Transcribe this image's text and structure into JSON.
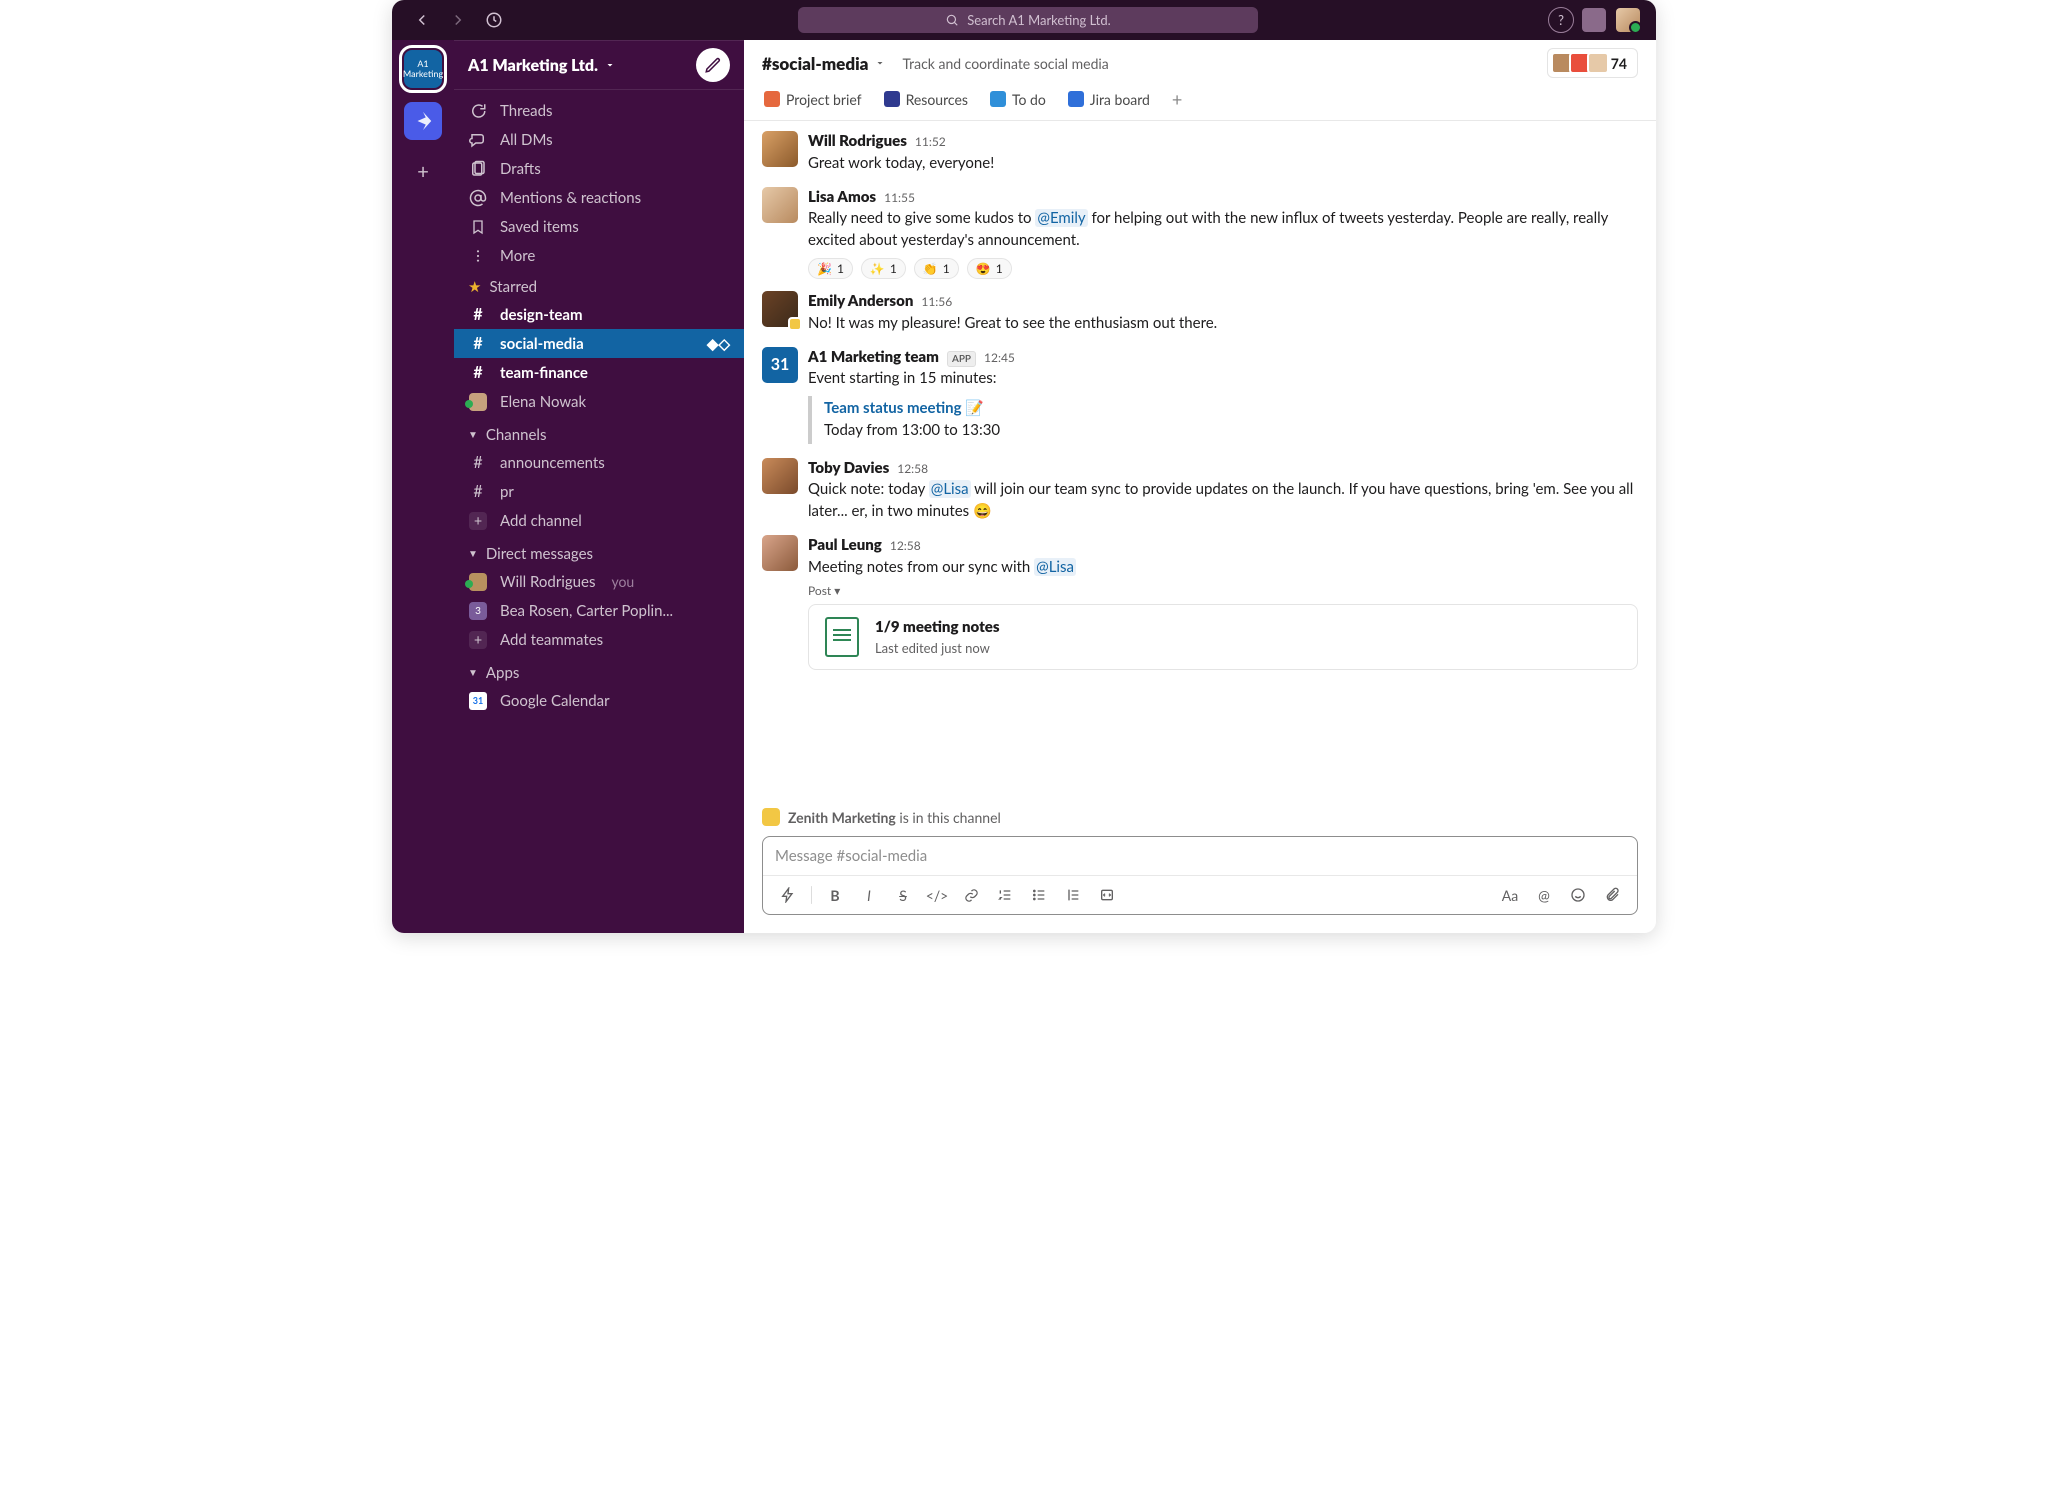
{
  "topbar": {
    "search_placeholder": "Search A1 Marketing Ltd."
  },
  "workspace": {
    "name": "A1 Marketing Ltd.",
    "rail_label": "A1\nMarketing"
  },
  "sidebar": {
    "nav": [
      {
        "icon": "threads-icon",
        "label": "Threads"
      },
      {
        "icon": "dms-icon",
        "label": "All DMs"
      },
      {
        "icon": "drafts-icon",
        "label": "Drafts"
      },
      {
        "icon": "mentions-icon",
        "label": "Mentions & reactions"
      },
      {
        "icon": "saved-icon",
        "label": "Saved items"
      },
      {
        "icon": "more-icon",
        "label": "More"
      }
    ],
    "starred_label": "Starred",
    "starred": [
      {
        "type": "channel",
        "name": "design-team",
        "bold": true
      },
      {
        "type": "channel",
        "name": "social-media",
        "bold": true,
        "active": true,
        "shared": true
      },
      {
        "type": "channel",
        "name": "team-finance",
        "bold": true
      },
      {
        "type": "dm",
        "name": "Elena Nowak"
      }
    ],
    "channels_label": "Channels",
    "channels": [
      {
        "name": "announcements"
      },
      {
        "name": "pr"
      }
    ],
    "add_channel": "Add channel",
    "dms_label": "Direct messages",
    "dms": [
      {
        "name": "Will Rodrigues",
        "you": "you"
      },
      {
        "name": "Bea Rosen, Carter Poplin...",
        "group": true,
        "count": "3"
      }
    ],
    "add_teammates": "Add teammates",
    "apps_label": "Apps",
    "apps": [
      {
        "name": "Google Calendar"
      }
    ]
  },
  "channel": {
    "name": "#social-media",
    "topic": "Track and coordinate social media",
    "member_count": "74",
    "bookmarks": [
      {
        "label": "Project brief",
        "color": "#e5683e"
      },
      {
        "label": "Resources",
        "color": "#2f3a8f"
      },
      {
        "label": "To do",
        "color": "#2f8fd9"
      },
      {
        "label": "Jira board",
        "color": "#2f6fd9"
      }
    ]
  },
  "messages": [
    {
      "author": "Will Rodrigues",
      "ts": "11:52",
      "avatar": "av-c1",
      "text": "Great work today, everyone!"
    },
    {
      "author": "Lisa Amos",
      "ts": "11:55",
      "avatar": "av-c2",
      "text_parts": [
        {
          "t": "Really need to give some kudos to "
        },
        {
          "mention": "@Emily"
        },
        {
          "t": " for helping out with the new influx of tweets yesterday. People are really, really excited about yesterday's announcement."
        }
      ],
      "reactions": [
        {
          "e": "🎉",
          "n": "1"
        },
        {
          "e": "✨",
          "n": "1"
        },
        {
          "e": "👏",
          "n": "1"
        },
        {
          "e": "😍",
          "n": "1"
        }
      ]
    },
    {
      "author": "Emily Anderson",
      "ts": "11:56",
      "avatar": "av-c3",
      "ext": true,
      "text": "No! It was my pleasure! Great to see the enthusiasm out there."
    },
    {
      "author": "A1 Marketing team",
      "ts": "12:45",
      "avatar": "av-c4",
      "avatar_text": "31",
      "app": true,
      "text": "Event starting in 15 minutes:",
      "event": {
        "title": "Team status meeting",
        "emoji": "📝",
        "time": "Today from 13:00 to 13:30"
      }
    },
    {
      "author": "Toby Davies",
      "ts": "12:58",
      "avatar": "av-c5",
      "text_parts": [
        {
          "t": "Quick note: today "
        },
        {
          "mention": "@Lisa"
        },
        {
          "t": " will join our team sync to provide updates on the launch. If you have questions, bring 'em. See you all later... er, in two minutes 😄"
        }
      ]
    },
    {
      "author": "Paul Leung",
      "ts": "12:58",
      "avatar": "av-c6",
      "text_parts": [
        {
          "t": "Meeting notes from our sync with "
        },
        {
          "mention": "@Lisa"
        }
      ],
      "post": {
        "label": "Post ▾",
        "title": "1/9 meeting notes",
        "sub": "Last edited just now"
      }
    }
  ],
  "external_notice": {
    "name": "Zenith Marketing",
    "tail": " is in this channel"
  },
  "composer": {
    "placeholder": "Message #social-media"
  }
}
